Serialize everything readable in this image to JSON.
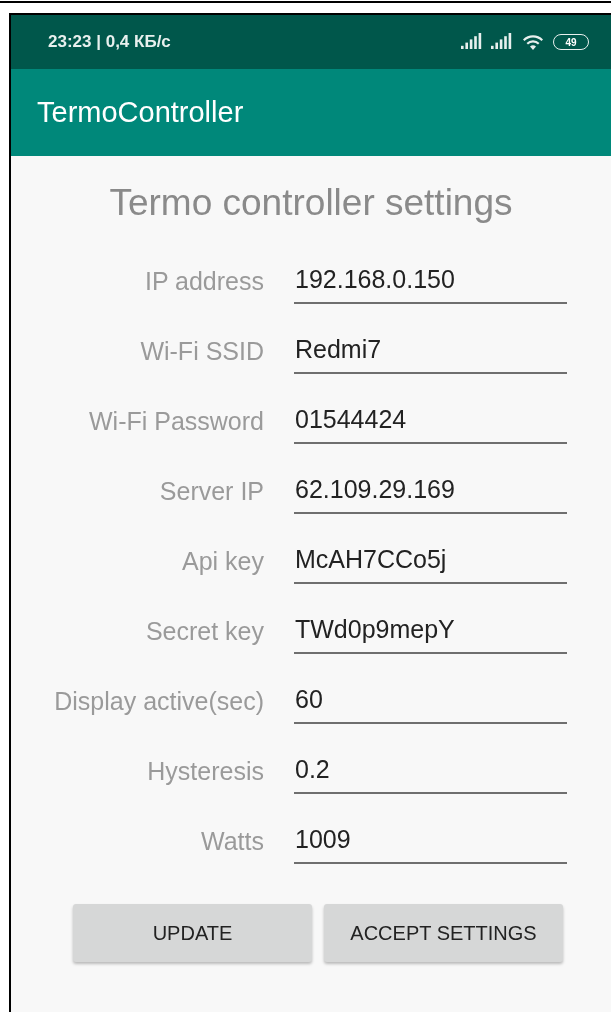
{
  "status_bar": {
    "time_speed": "23:23 | 0,4 КБ/с",
    "battery": "49"
  },
  "app_bar": {
    "title": "TermoController"
  },
  "heading": "Termo controller settings",
  "fields": [
    {
      "label": "IP address",
      "value": "192.168.0.150"
    },
    {
      "label": "Wi-Fi SSID",
      "value": "Redmi7"
    },
    {
      "label": "Wi-Fi Password",
      "value": "01544424"
    },
    {
      "label": "Server IP",
      "value": "62.109.29.169"
    },
    {
      "label": "Api key",
      "value": "McAH7CCo5j"
    },
    {
      "label": "Secret key",
      "value": "TWd0p9mepY"
    },
    {
      "label": "Display active(sec)",
      "value": "60"
    },
    {
      "label": "Hysteresis",
      "value": "0.2"
    },
    {
      "label": "Watts",
      "value": "1009"
    }
  ],
  "buttons": [
    "UPDATE",
    "ACCEPT SETTINGS"
  ]
}
